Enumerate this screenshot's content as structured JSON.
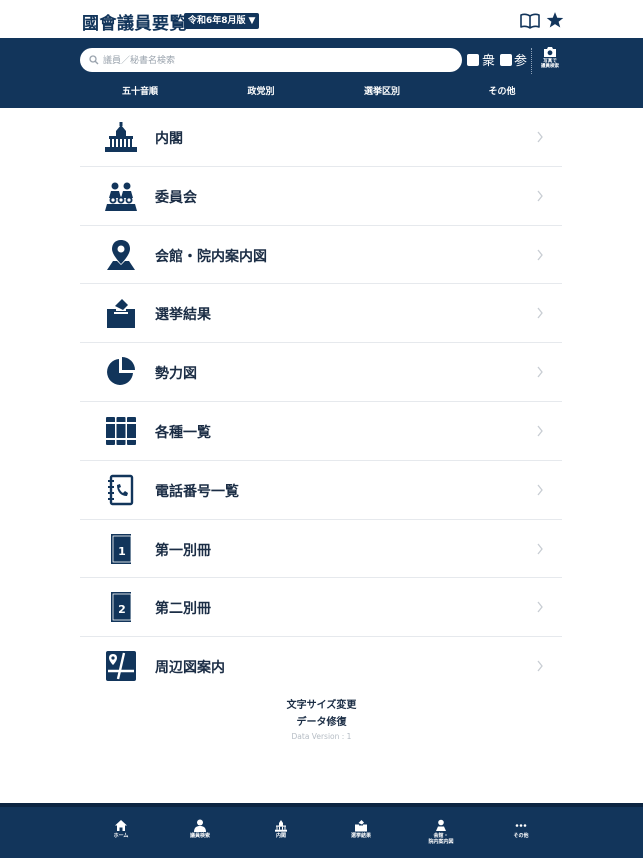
{
  "header": {
    "title": "國會議員要覧",
    "edition": "令和6年8月版"
  },
  "search": {
    "placeholder": "議員／秘書名検索",
    "filter_house_rep": "衆",
    "filter_councillors": "参",
    "camera_label": "写真で\n議員検索"
  },
  "tabs": [
    {
      "label": "五十音順"
    },
    {
      "label": "政党別"
    },
    {
      "label": "選挙区別"
    },
    {
      "label": "その他"
    }
  ],
  "menu": [
    {
      "label": "内閣",
      "icon": "diet-building-icon"
    },
    {
      "label": "委員会",
      "icon": "committee-icon"
    },
    {
      "label": "会館・院内案内図",
      "icon": "location-pin-icon"
    },
    {
      "label": "選挙結果",
      "icon": "ballot-box-icon"
    },
    {
      "label": "勢力図",
      "icon": "pie-chart-icon"
    },
    {
      "label": "各種一覧",
      "icon": "binders-icon"
    },
    {
      "label": "電話番号一覧",
      "icon": "phone-book-icon"
    },
    {
      "label": "第一別冊",
      "icon": "book-1-icon"
    },
    {
      "label": "第二別冊",
      "icon": "book-2-icon"
    },
    {
      "label": "周辺図案内",
      "icon": "map-icon"
    }
  ],
  "footer": {
    "font_size_link": "文字サイズ変更",
    "data_repair_link": "データ修復",
    "version": "Data Version : 1"
  },
  "bottom_nav": [
    {
      "label": "ホーム",
      "icon": "home-icon"
    },
    {
      "label": "議員検索",
      "icon": "member-search-icon"
    },
    {
      "label": "内閣",
      "icon": "diet-building-icon"
    },
    {
      "label": "選挙結果",
      "icon": "ballot-box-icon"
    },
    {
      "label": "会館・\n院内案内図",
      "icon": "location-person-icon"
    },
    {
      "label": "その他",
      "icon": "more-icon"
    }
  ],
  "colors": {
    "brand_navy": "#12355b",
    "text": "#1b2d45",
    "divider": "#e6e9ed"
  }
}
